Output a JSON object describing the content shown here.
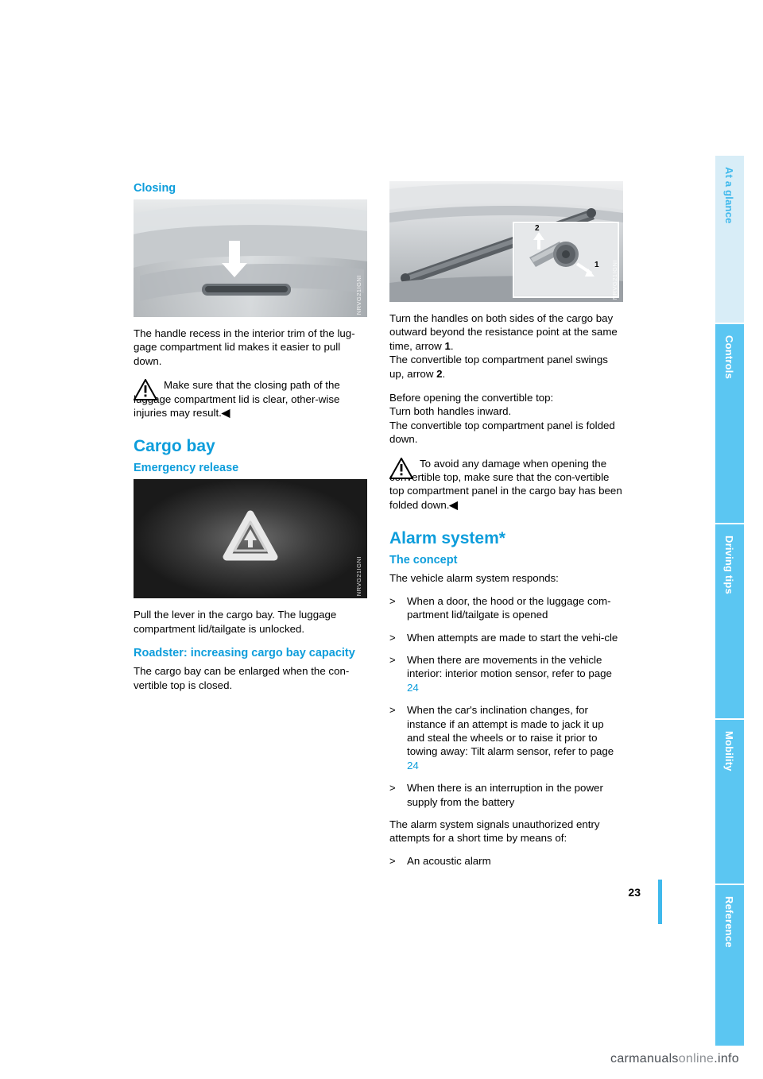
{
  "page": {
    "number": "23",
    "footer_text_1": "carmanuals",
    "footer_text_2": "online",
    "footer_text_3": ".info"
  },
  "side_tabs": [
    {
      "label": "At a glance",
      "name": "tab-at-a-glance"
    },
    {
      "label": "Controls",
      "name": "tab-controls"
    },
    {
      "label": "Driving tips",
      "name": "tab-driving-tips"
    },
    {
      "label": "Mobility",
      "name": "tab-mobility"
    },
    {
      "label": "Reference",
      "name": "tab-reference"
    }
  ],
  "left_column": {
    "heading_closing": "Closing",
    "figure1_code": "NRVG21IGNI",
    "para1": "The handle recess in the interior trim of the lug-gage compartment lid makes it easier to pull down.",
    "warning1": "Make sure that the closing path of the luggage compartment lid is clear, other-wise injuries may result.",
    "warning1_end": "◀",
    "heading_cargo_bay": "Cargo bay",
    "heading_emergency_release": "Emergency release",
    "figure2_code": "NRVG21IGNI",
    "para2": "Pull the lever in the cargo bay. The luggage compartment lid/tailgate is unlocked.",
    "heading_roadster": "Roadster: increasing cargo bay capacity",
    "para3": "The cargo bay can be enlarged when the con-vertible top is closed."
  },
  "right_column": {
    "figure3_code": "NRVG21IGNI",
    "figure3_callout_1": "1",
    "figure3_callout_2": "2",
    "para1_a": "Turn the handles on both sides of the cargo bay outward beyond the resistance point at the same time, arrow ",
    "para1_bold": "1",
    "para1_b": ".",
    "para1_c": "The convertible top compartment panel swings up, arrow ",
    "para1_bold2": "2",
    "para1_d": ".",
    "para2_a": "Before opening the convertible top:",
    "para2_b": "Turn both handles inward.",
    "para2_c": "The convertible top compartment panel is folded down.",
    "warning1": "To avoid any damage when opening the convertible top, make sure that the con-vertible top compartment panel in the cargo bay has been folded down.",
    "warning1_end": "◀",
    "heading_alarm": "Alarm system*",
    "heading_concept": "The concept",
    "para3": "The vehicle alarm system responds:",
    "bullets": [
      {
        "text": "When a door, the hood or the luggage com-partment lid/tailgate is opened"
      },
      {
        "text": "When attempts are made to start the vehi-cle"
      },
      {
        "text": "When there are movements in the vehicle interior: interior motion sensor, refer to page ",
        "xref": "24"
      },
      {
        "text": "When the car's inclination changes, for instance if an attempt is made to jack it up and steal the wheels or to raise it prior to towing away: Tilt alarm sensor, refer to page ",
        "xref": "24"
      },
      {
        "text": "When there is an interruption in the power supply from the battery"
      }
    ],
    "para4": "The alarm system signals unauthorized entry attempts for a short time by means of:",
    "bullets2": [
      {
        "text": "An acoustic alarm"
      }
    ]
  },
  "colors": {
    "accent": "#0d9ddb",
    "tab_light": "#d8edf7",
    "tab_mid": "#5bc6f2",
    "tab_dark": "#35b6ea"
  }
}
